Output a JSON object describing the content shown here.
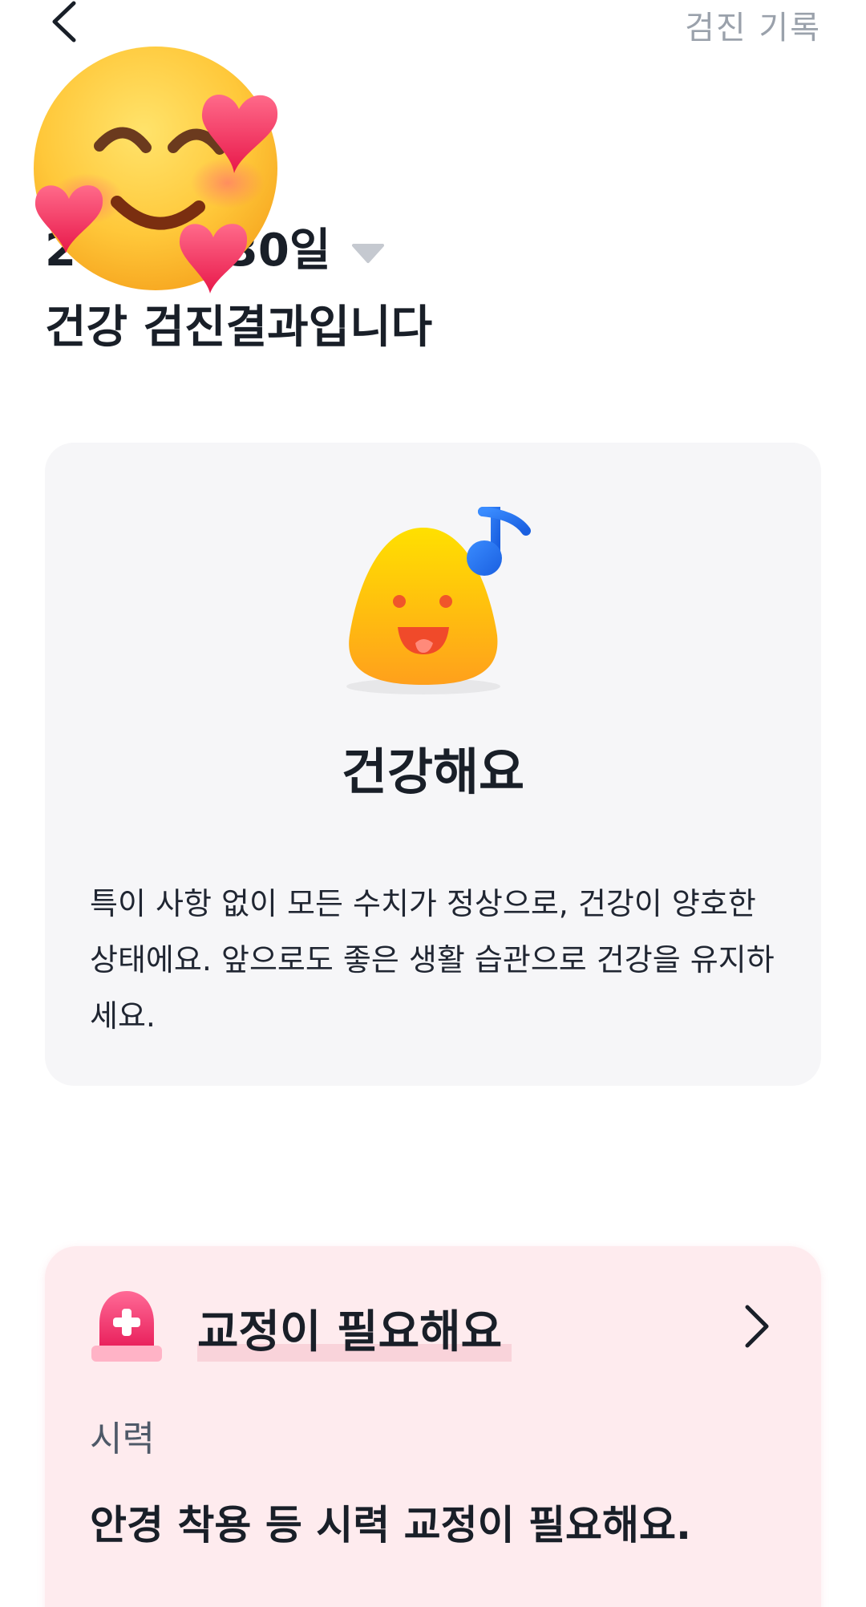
{
  "topbar": {
    "back_icon": "chevron-left-icon",
    "history_link": "검진 기록"
  },
  "header": {
    "date_visible": "2      월 30일",
    "title_line2": "건강 검진결과입니다",
    "caret_icon": "caret-down-icon"
  },
  "sticker": {
    "icon": "smiling-face-with-hearts-icon"
  },
  "health_card": {
    "mascot_icon": "happy-blob-with-music-note-icon",
    "status": "건강해요",
    "description": "특이 사항 없이 모든 수치가 정상으로, 건강이 양호한 상태에요. 앞으로도 좋은 생활 습관으로 건강을 유지하세요."
  },
  "correction_card": {
    "icon": "siren-icon",
    "title": "교정이 필요해요",
    "chevron_icon": "chevron-right-icon",
    "category": "시력",
    "description": "안경 착용 등 시력 교정이 필요해요."
  },
  "colors": {
    "card_bg": "#f6f6f8",
    "correction_bg": "#feebee",
    "highlight": "#f9d3da",
    "muted_text": "#9aa1ab",
    "siren_red": "#f0306a"
  }
}
